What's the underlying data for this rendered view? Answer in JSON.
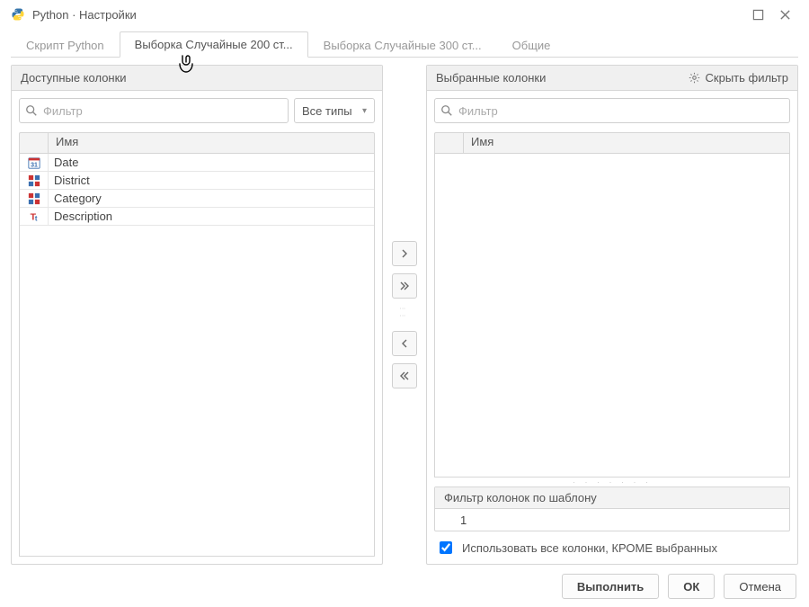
{
  "window": {
    "title": "Python · Настройки"
  },
  "tabs": {
    "items": [
      {
        "label": "Скрипт Python"
      },
      {
        "label": "Выборка Случайные 200 ст..."
      },
      {
        "label": "Выборка Случайные 300 ст..."
      },
      {
        "label": "Общие"
      }
    ],
    "active_index": 1
  },
  "left": {
    "title": "Доступные колонки",
    "filter_placeholder": "Фильтр",
    "types_label": "Все типы",
    "col_header": "Имя",
    "rows": [
      {
        "icon": "calendar",
        "name": "Date"
      },
      {
        "icon": "grid",
        "name": "District"
      },
      {
        "icon": "grid",
        "name": "Category"
      },
      {
        "icon": "text",
        "name": "Description"
      }
    ]
  },
  "right": {
    "title": "Выбранные колонки",
    "hide_filter": "Скрыть фильтр",
    "filter_placeholder": "Фильтр",
    "col_header": "Имя",
    "pattern_label": "Фильтр колонок по шаблону",
    "pattern_value": "1",
    "use_except_label": "Использовать все колонки, КРОМЕ выбранных",
    "use_except_checked": true
  },
  "buttons": {
    "execute": "Выполнить",
    "ok": "ОК",
    "cancel": "Отмена"
  }
}
